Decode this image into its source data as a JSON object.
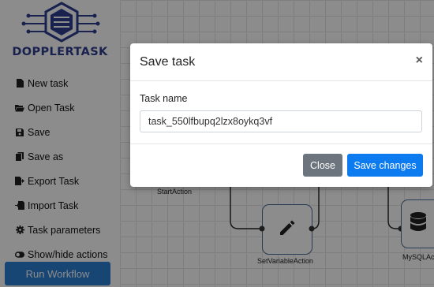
{
  "brand": {
    "name": "DOPPLERTASK",
    "color": "#2e3f8f"
  },
  "sidebar": {
    "items": [
      {
        "label": "New task",
        "icon": "file-icon"
      },
      {
        "label": "Open Task",
        "icon": "folder-open-icon"
      },
      {
        "label": "Save",
        "icon": "save-icon"
      },
      {
        "label": "Save as",
        "icon": "copy-icon"
      },
      {
        "label": "Export Task",
        "icon": "file-export-icon"
      },
      {
        "label": "Import Task",
        "icon": "file-import-icon"
      },
      {
        "label": "Task parameters",
        "icon": "gear-icon"
      },
      {
        "label": "Show/hide actions",
        "icon": "toggle-icon"
      }
    ],
    "run_label": "Run Workflow",
    "run_color": "#2a7fd4"
  },
  "canvas": {
    "nodes": [
      {
        "label": "StartAction"
      },
      {
        "label": "SetVariableAction",
        "icon": "pencil-icon"
      },
      {
        "label": "MySQLAc",
        "icon": "database-icon"
      }
    ]
  },
  "modal": {
    "title": "Save task",
    "close_symbol": "×",
    "field_label": "Task name",
    "field_value": "task_550lfbupq2lzx8oykq3vf",
    "buttons": {
      "close": "Close",
      "save": "Save changes"
    },
    "colors": {
      "close": "#6c757d",
      "save": "#0d7bf0"
    }
  }
}
